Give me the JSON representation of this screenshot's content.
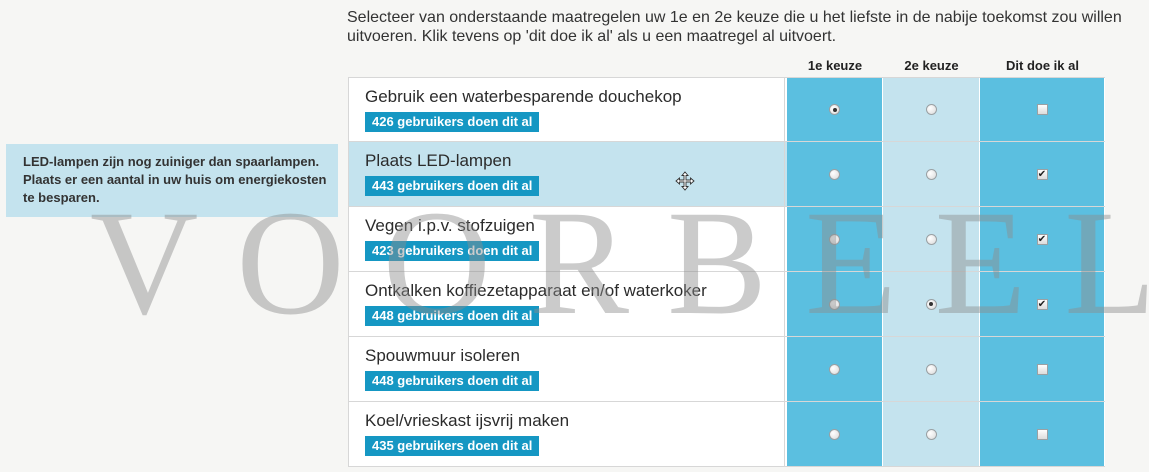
{
  "intro_text": "Selecteer van onderstaande maatregelen uw 1e en 2e keuze die u het liefste in de nabije toekomst zou willen uitvoeren. Klik tevens op 'dit doe ik al' als u een maatregel al uitvoert.",
  "columns": {
    "first": "1e keuze",
    "second": "2e keuze",
    "already": "Dit doe ik al"
  },
  "tooltip": "LED-lampen zijn nog zuiniger dan spaarlampen. Plaats er een aantal in uw huis om energiekosten te besparen.",
  "watermark": "VOORBEELD",
  "rows": [
    {
      "title": "Gebruik een waterbesparende douchekop",
      "badge": "426 gebruikers doen dit al",
      "first": true,
      "second": false,
      "already": false
    },
    {
      "title": "Plaats LED-lampen",
      "badge": "443 gebruikers doen dit al",
      "first": false,
      "second": false,
      "already": true
    },
    {
      "title": "Vegen i.p.v. stofzuigen",
      "badge": "423 gebruikers doen dit al",
      "first": false,
      "second": false,
      "already": true
    },
    {
      "title": "Ontkalken koffiezetapparaat en/of waterkoker",
      "badge": "448 gebruikers doen dit al",
      "first": false,
      "second": true,
      "already": true
    },
    {
      "title": "Spouwmuur isoleren",
      "badge": "448 gebruikers doen dit al",
      "first": false,
      "second": false,
      "already": false
    },
    {
      "title": "Koel/vrieskast ijsvrij maken",
      "badge": "435 gebruikers doen dit al",
      "first": false,
      "second": false,
      "already": false
    }
  ],
  "highlighted_row": 1,
  "colors": {
    "accent": "#5bbfe0",
    "light": "#c4e3ee",
    "badge": "#1597c3"
  }
}
